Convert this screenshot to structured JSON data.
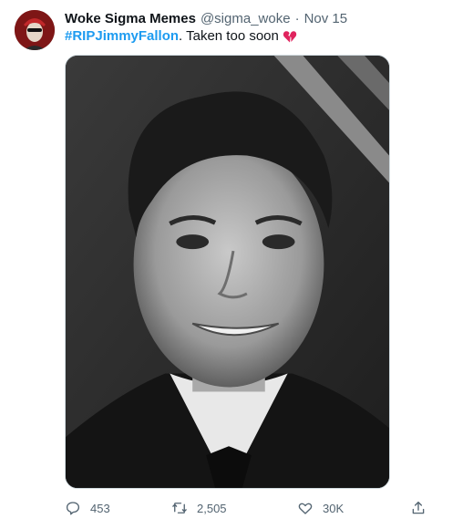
{
  "tweet": {
    "author_name": "Woke Sigma Memes",
    "author_handle": "@sigma_woke",
    "separator": "·",
    "date": "Nov 15",
    "hashtag": "#RIPJimmyFallon",
    "text": ". Taken too soon",
    "emoji_icon": "broken-heart-icon",
    "media_description": "black-and-white-portrait-photo"
  },
  "actions": {
    "reply_count": "453",
    "retweet_count": "2,505",
    "like_count": "30K"
  },
  "colors": {
    "accent": "#1d9bf0",
    "secondary_text": "#536471",
    "primary_text": "#0f1419",
    "broken_heart": "#e0245e"
  }
}
